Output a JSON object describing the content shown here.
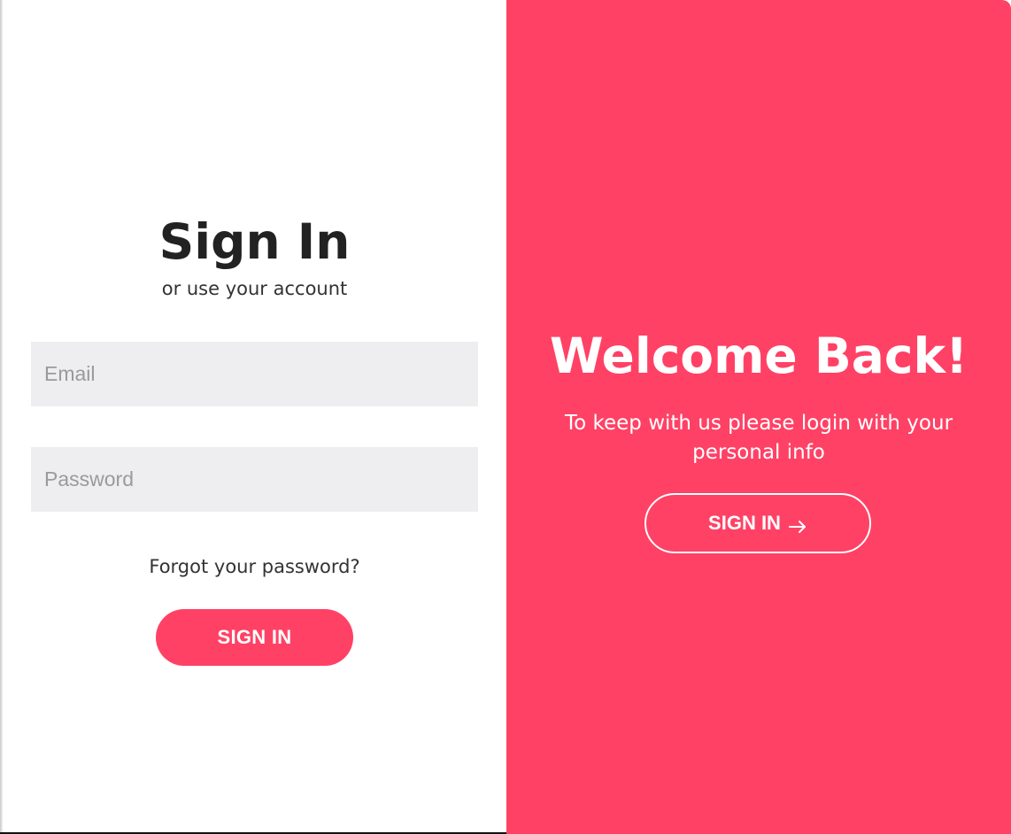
{
  "signin": {
    "title": "Sign In",
    "subtitle": "or use your account",
    "email_placeholder": "Email",
    "password_placeholder": "Password",
    "forgot_label": "Forgot your password?",
    "button_label": "SIGN IN"
  },
  "overlay": {
    "title": "Welcome Back!",
    "text": "To keep with us please login with your personal info",
    "button_label": "SIGN IN",
    "button_icon": "arrow-right-icon"
  },
  "colors": {
    "accent": "#ff4165",
    "input_bg": "#eeeef0",
    "heading": "#222222",
    "body_text": "#333333"
  }
}
